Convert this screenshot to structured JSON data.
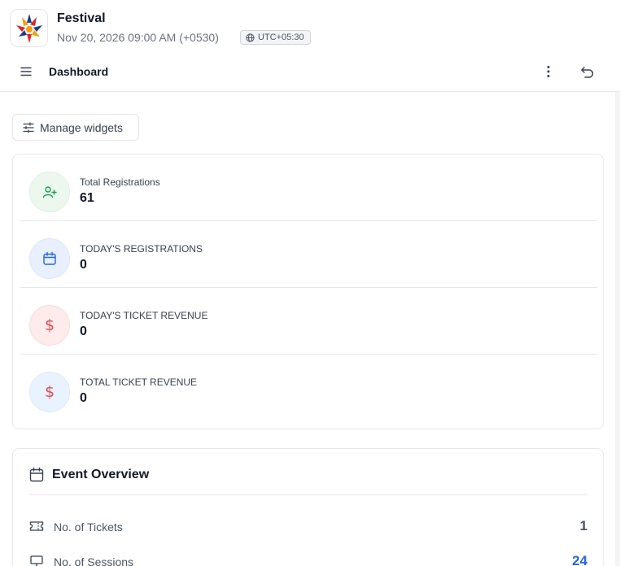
{
  "event": {
    "name": "Festival",
    "datetime": "Nov 20, 2026 09:00 AM (+0530)",
    "timezone": "UTC+05:30"
  },
  "toolbar": {
    "title": "Dashboard"
  },
  "manage_widgets": {
    "label": "Manage widgets"
  },
  "stats": [
    {
      "label": "Total Registrations",
      "value": "61",
      "icon": "user-plus-icon",
      "color": "#16a34a"
    },
    {
      "label": "TODAY'S REGISTRATIONS",
      "value": "0",
      "icon": "calendar-icon",
      "color": "#2563eb"
    },
    {
      "label": "TODAY'S TICKET REVENUE",
      "value": "0",
      "icon": "dollar-icon",
      "color": "#e5484d"
    },
    {
      "label": "TOTAL TICKET REVENUE",
      "value": "0",
      "icon": "dollar-icon",
      "color": "#e5484d"
    }
  ],
  "overview": {
    "title": "Event Overview",
    "rows": [
      {
        "label": "No. of Tickets",
        "value": "1",
        "icon": "ticket-icon",
        "value_color": "#4b5563"
      },
      {
        "label": "No. of Sessions",
        "value": "24",
        "icon": "presentation-icon",
        "value_color": "#2563eb"
      }
    ]
  }
}
